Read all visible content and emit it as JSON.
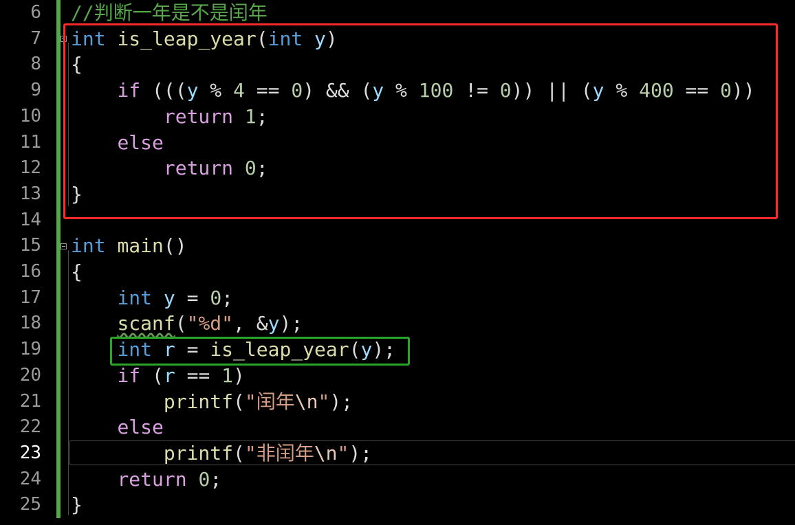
{
  "editor": {
    "current_line": 23,
    "lines": [
      {
        "n": "6"
      },
      {
        "n": "7"
      },
      {
        "n": "8"
      },
      {
        "n": "9"
      },
      {
        "n": "10"
      },
      {
        "n": "11"
      },
      {
        "n": "12"
      },
      {
        "n": "13"
      },
      {
        "n": "14"
      },
      {
        "n": "15"
      },
      {
        "n": "16"
      },
      {
        "n": "17"
      },
      {
        "n": "18"
      },
      {
        "n": "19"
      },
      {
        "n": "20"
      },
      {
        "n": "21"
      },
      {
        "n": "22"
      },
      {
        "n": "23"
      },
      {
        "n": "24"
      },
      {
        "n": "25"
      }
    ],
    "tokens": {
      "comment": "//判断一年是不是闰年",
      "int": "int",
      "is_leap_year": "is_leap_year",
      "param_y": "y",
      "if": "if",
      "else": "else",
      "return": "return",
      "main": "main",
      "scanf": "scanf",
      "printf": "printf",
      "var_y": "y",
      "var_r": "r",
      "n0": "0",
      "n1": "1",
      "n4": "4",
      "n100": "100",
      "n400": "400",
      "fmt_d": "\"%d\"",
      "str_leap_pre": "\"闰年",
      "str_nonleap_pre": "\"非闰年",
      "esc_n": "\\n",
      "quote": "\""
    }
  },
  "highlights": {
    "red_box_color": "#ff2a2a",
    "green_box_color": "#2aa52a"
  }
}
